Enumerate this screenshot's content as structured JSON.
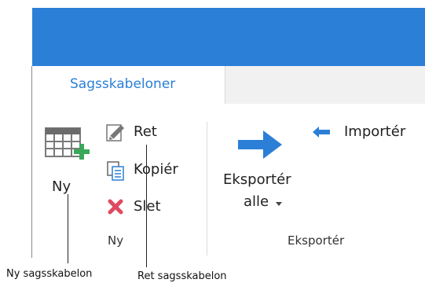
{
  "ribbon": {
    "tab_label": "Sagsskabeloner",
    "groups": {
      "ny": {
        "ny_label": "Ny",
        "ret_label": "Ret",
        "kopier_label": "Kopiér",
        "slet_label": "Slet",
        "group_label": "Ny"
      },
      "eksporter": {
        "eksporter_alle_line1": "Eksportér",
        "eksporter_alle_line2": "alle",
        "importer_label": "Importér",
        "group_label": "Eksportér"
      }
    }
  },
  "callouts": {
    "ny": "Ny sagsskabelon",
    "ret": "Ret sagsskabelon"
  },
  "colors": {
    "accent": "#2b7fd6",
    "delete": "#e04a5f",
    "add": "#3aa85a"
  }
}
